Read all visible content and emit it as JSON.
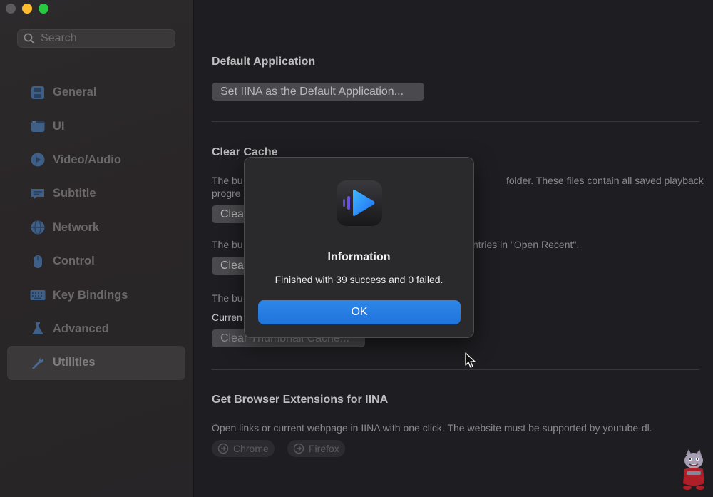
{
  "sidebar": {
    "search_placeholder": "Search",
    "items": [
      {
        "label": "General",
        "icon": "general-icon"
      },
      {
        "label": "UI",
        "icon": "ui-icon"
      },
      {
        "label": "Video/Audio",
        "icon": "video-audio-icon"
      },
      {
        "label": "Subtitle",
        "icon": "subtitle-icon"
      },
      {
        "label": "Network",
        "icon": "network-icon"
      },
      {
        "label": "Control",
        "icon": "control-icon"
      },
      {
        "label": "Key Bindings",
        "icon": "keyboard-icon"
      },
      {
        "label": "Advanced",
        "icon": "flask-icon"
      },
      {
        "label": "Utilities",
        "icon": "wrench-icon"
      }
    ],
    "active_item": "Utilities"
  },
  "main": {
    "default_app": {
      "title": "Default Application",
      "button": "Set IINA as the Default Application..."
    },
    "clear_cache": {
      "title": "Clear Cache",
      "desc1_start": "The bu",
      "desc1_end": "folder. These files contain all saved playback",
      "desc1_line2": "progre",
      "btn1": "Clea",
      "desc2_start": "The bu",
      "desc2_end": "ntries in \"Open Recent\".",
      "btn2": "Clea",
      "desc3_start": "The bu",
      "current_label": "Curren",
      "btn3": "Clear Thumbnail Cache..."
    },
    "browser_ext": {
      "title": "Get Browser Extensions for IINA",
      "desc": "Open links or current webpage in IINA with one click. The website must be supported by youtube-dl.",
      "chrome": "Chrome",
      "firefox": "Firefox"
    }
  },
  "dialog": {
    "title": "Information",
    "message": "Finished with 39 success and 0 failed.",
    "ok": "OK"
  },
  "colors": {
    "accent": "#1f74dc",
    "window_bg": "#1e1e22",
    "sidebar_bg": "#2a2627"
  }
}
